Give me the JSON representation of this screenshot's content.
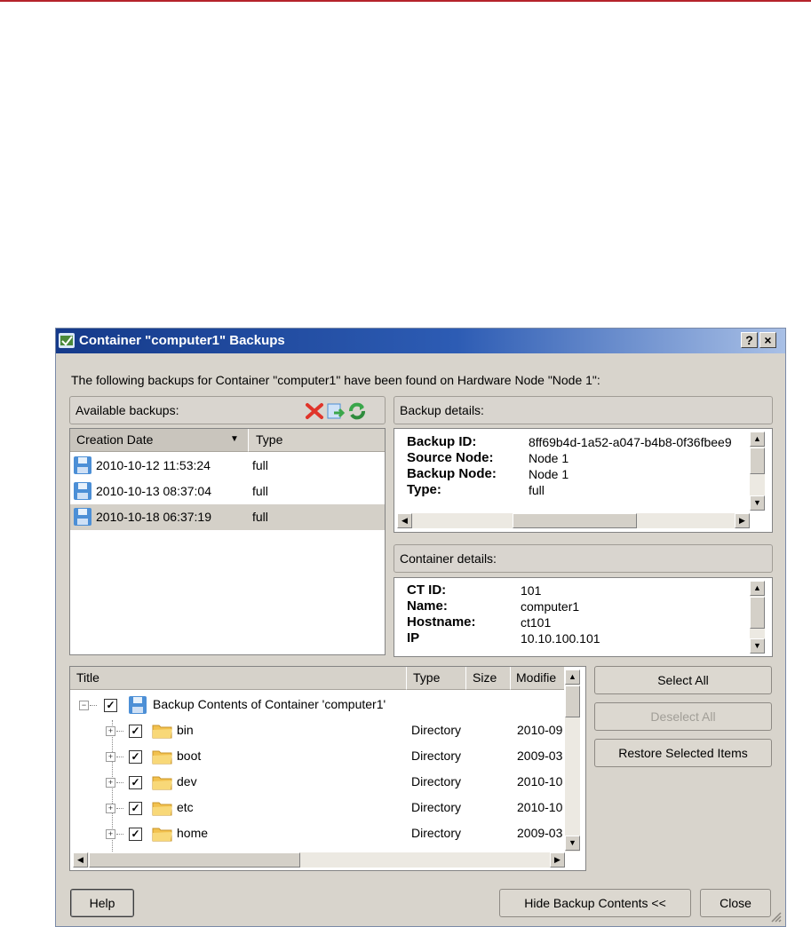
{
  "window": {
    "title": "Container \"computer1\" Backups",
    "help_glyph": "?",
    "close_glyph": "×"
  },
  "intro_text": "The following backups for Container \"computer1\" have been found on Hardware Node \"Node 1\":",
  "available": {
    "heading": "Available backups:",
    "icons": [
      "delete-icon",
      "restore-icon",
      "refresh-icon"
    ],
    "columns": [
      "Creation Date",
      "Type"
    ],
    "sort_glyph": "▼",
    "rows": [
      {
        "date": "2010-10-12 11:53:24",
        "type": "full"
      },
      {
        "date": "2010-10-13 08:37:04",
        "type": "full"
      },
      {
        "date": "2010-10-18 06:37:19",
        "type": "full"
      }
    ],
    "selected_index": 2
  },
  "backup_details": {
    "heading": "Backup details:",
    "fields": [
      {
        "label": "Backup ID:",
        "value": "8ff69b4d-1a52-a047-b4b8-0f36fbee9"
      },
      {
        "label": "Source Node:",
        "value": "Node 1"
      },
      {
        "label": "Backup Node:",
        "value": "Node 1"
      },
      {
        "label": "Type:",
        "value": "full"
      }
    ]
  },
  "container_details": {
    "heading": "Container details:",
    "fields": [
      {
        "label": "CT ID:",
        "value": "101"
      },
      {
        "label": "Name:",
        "value": "computer1"
      },
      {
        "label": "Hostname:",
        "value": "ct101"
      },
      {
        "label": "IP",
        "value": "10.10.100.101"
      }
    ]
  },
  "contents": {
    "columns": [
      "Title",
      "Type",
      "Size",
      "Modifie"
    ],
    "root": "Backup Contents of Container 'computer1'",
    "items": [
      {
        "name": "bin",
        "type": "Directory",
        "modified": "2010-09"
      },
      {
        "name": "boot",
        "type": "Directory",
        "modified": "2009-03"
      },
      {
        "name": "dev",
        "type": "Directory",
        "modified": "2010-10"
      },
      {
        "name": "etc",
        "type": "Directory",
        "modified": "2010-10"
      },
      {
        "name": "home",
        "type": "Directory",
        "modified": "2009-03"
      }
    ]
  },
  "buttons": {
    "select_all": "Select All",
    "deselect_all": "Deselect All",
    "restore_selected": "Restore Selected Items",
    "help": "Help",
    "hide_contents": "Hide Backup Contents <<",
    "close": "Close"
  },
  "colors": {
    "title_bar": "#2d5cb4",
    "dialog_bg": "#d8d4cc",
    "top_accent": "#b5232a",
    "delete_icon": "#e0342a",
    "refresh_icon": "#3aa64a"
  }
}
